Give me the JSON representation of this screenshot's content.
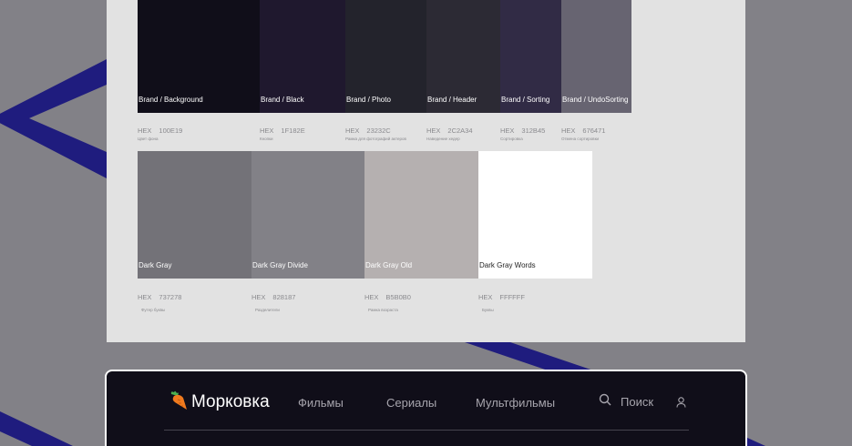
{
  "colors": {
    "page_bg": "#828187",
    "panel_bg": "#e2e2e2",
    "stripe": "#1f1c7e",
    "header_bg": "#100e19"
  },
  "palette_row1": [
    {
      "name": "Brand / Background",
      "hex_label": "HEX",
      "hex": "100E19",
      "desc": "Цвет фона",
      "color": "#100e19"
    },
    {
      "name": "Brand / Black",
      "hex_label": "HEX",
      "hex": "1F182E",
      "desc": "Кнопки",
      "color": "#1f182e"
    },
    {
      "name": "Brand / Photo",
      "hex_label": "HEX",
      "hex": "23232C",
      "desc": "Рамка для фотографий актеров",
      "color": "#23232c"
    },
    {
      "name": "Brand / Header",
      "hex_label": "HEX",
      "hex": "2C2A34",
      "desc": "Наведение хедер",
      "color": "#2c2a34"
    },
    {
      "name": "Brand / Sorting",
      "hex_label": "HEX",
      "hex": "312B45",
      "desc": "Сортировка",
      "color": "#312b45"
    },
    {
      "name": "Brand / UndoSorting",
      "hex_label": "HEX",
      "hex": "676471",
      "desc": "Отмена сортировки",
      "color": "#676471"
    }
  ],
  "palette_row2": [
    {
      "name": "Dark Gray",
      "hex_label": "HEX",
      "hex": "737278",
      "desc": "Футер буквы",
      "color": "#737278"
    },
    {
      "name": "Dark Gray Divide",
      "hex_label": "HEX",
      "hex": "828187",
      "desc": "Разделители",
      "color": "#828187"
    },
    {
      "name": "Dark Gray Old",
      "hex_label": "HEX",
      "hex": "B5B0B0",
      "desc": "Рамка возраста",
      "color": "#b5b0b0"
    },
    {
      "name": "Dark Gray Words",
      "hex_label": "HEX",
      "hex": "FFFFFF",
      "desc": "Буквы",
      "color": "#ffffff"
    }
  ],
  "header": {
    "logo_text": "Морковка",
    "logo_icon": "carrot-icon",
    "nav": [
      "Фильмы",
      "Сериалы",
      "Мультфильмы"
    ],
    "search_label": "Поиск",
    "search_icon": "search-icon",
    "user_icon": "user-icon"
  }
}
